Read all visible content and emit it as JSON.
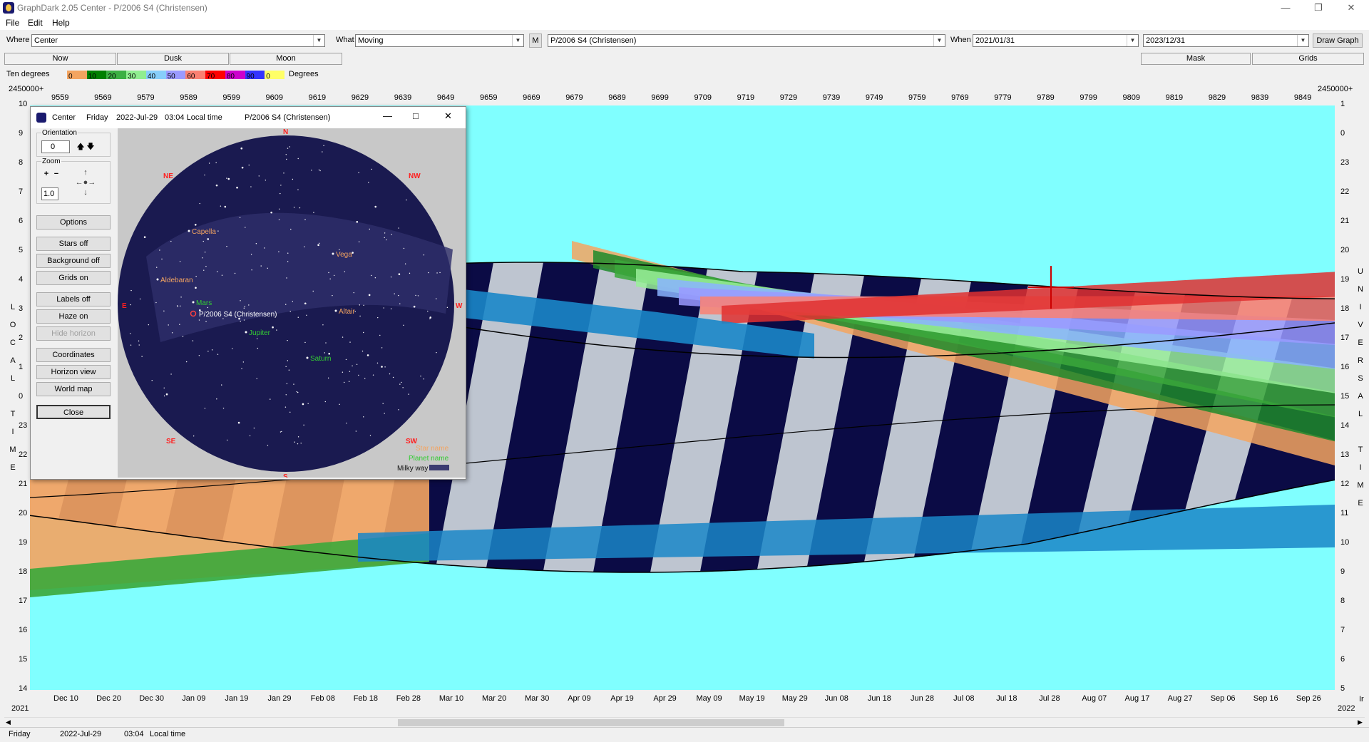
{
  "window": {
    "title": "GraphDark 2.05  Center  -  P/2006 S4 (Christensen)"
  },
  "menu": [
    "File",
    "Edit",
    "Help"
  ],
  "toolbar": {
    "where_label": "Where",
    "where_value": "Center",
    "what_label": "What",
    "what_value": "Moving",
    "m_button": "M",
    "object_value": "P/2006 S4 (Christensen)",
    "when_label": "When",
    "start_date": "2021/01/31",
    "end_date": "2023/12/31",
    "draw_button": "Draw Graph"
  },
  "tabs": {
    "now": "Now",
    "dusk": "Dusk",
    "moon": "Moon",
    "mask": "Mask",
    "grids": "Grids"
  },
  "legend": {
    "left_label": "Ten degrees",
    "right_label": "Degrees",
    "steps": [
      {
        "label": "0",
        "color": "#f4a460"
      },
      {
        "label": "10",
        "color": "#008000"
      },
      {
        "label": "20",
        "color": "#3cb043"
      },
      {
        "label": "30",
        "color": "#90ee90"
      },
      {
        "label": "40",
        "color": "#87cefa"
      },
      {
        "label": "50",
        "color": "#9a9aff"
      },
      {
        "label": "60",
        "color": "#fa8072"
      },
      {
        "label": "70",
        "color": "#ff0000"
      },
      {
        "label": "80",
        "color": "#cc00cc"
      },
      {
        "label": "90",
        "color": "#3333ff"
      },
      {
        "label": "0",
        "color": "#ffff66"
      }
    ]
  },
  "graph": {
    "jd_left": "2450000+",
    "jd_right": "2450000+",
    "jd_ticks": [
      "9559",
      "9569",
      "9579",
      "9589",
      "9599",
      "9609",
      "9619",
      "9629",
      "9639",
      "9649",
      "9659",
      "9669",
      "9679",
      "9689",
      "9699",
      "9709",
      "9719",
      "9729",
      "9739",
      "9749",
      "9759",
      "9769",
      "9779",
      "9789",
      "9799",
      "9809",
      "9819",
      "9829",
      "9839",
      "9849"
    ],
    "date_ticks": [
      "Dec 10",
      "Dec 20",
      "Dec 30",
      "Jan 09",
      "Jan 19",
      "Jan 29",
      "Feb 08",
      "Feb 18",
      "Feb 28",
      "Mar 10",
      "Mar 20",
      "Mar 30",
      "Apr 09",
      "Apr 19",
      "Apr 29",
      "May 09",
      "May 19",
      "May 29",
      "Jun 08",
      "Jun 18",
      "Jun 28",
      "Jul 08",
      "Jul 18",
      "Jul 28",
      "Aug 07",
      "Aug 17",
      "Aug 27",
      "Sep 06",
      "Sep 16",
      "Sep 26"
    ],
    "year_left": "2021",
    "year_right": "2022",
    "year_right_extra": "Ir",
    "left_hours": [
      "10",
      "9",
      "8",
      "7",
      "6",
      "5",
      "4",
      "3",
      "2",
      "1",
      "0",
      "23",
      "22",
      "21",
      "20",
      "19",
      "18",
      "17",
      "16",
      "15",
      "14"
    ],
    "right_hours": [
      "1",
      "0",
      "23",
      "22",
      "21",
      "20",
      "19",
      "18",
      "17",
      "16",
      "15",
      "14",
      "13",
      "12",
      "11",
      "10",
      "9",
      "8",
      "7",
      "6",
      "5"
    ],
    "left_axis_title": [
      "L",
      "O",
      "C",
      "A",
      "L",
      "",
      "T",
      "I",
      "M",
      "E"
    ],
    "right_axis_title": [
      "U",
      "N",
      "I",
      "V",
      "E",
      "R",
      "S",
      "A",
      "L",
      "",
      "T",
      "I",
      "M",
      "E"
    ]
  },
  "sky_window": {
    "title_where": "Center",
    "title_day": "Friday",
    "title_date": "2022-Jul-29",
    "title_time": "03:04 Local time",
    "title_object": "P/2006 S4 (Christensen)",
    "orientation_label": "Orientation",
    "orientation_value": "0",
    "zoom_label": "Zoom",
    "zoom_value": "1.0",
    "buttons": [
      "Options",
      "Stars off",
      "Background off",
      "Grids on",
      "Labels off",
      "Haze on",
      "Hide horizon",
      "Coordinates",
      "Horizon view",
      "World map",
      "Close"
    ],
    "compass": {
      "N": "N",
      "NE": "NE",
      "NW": "NW",
      "E": "E",
      "W": "W",
      "SE": "SE",
      "SW": "SW",
      "S": "S"
    },
    "stars": [
      "Capella",
      "Vega",
      "Aldebaran",
      "Altair"
    ],
    "planets": [
      "Mars",
      "Jupiter",
      "Saturn"
    ],
    "target": "P/2006 S4 (Christensen)",
    "legend_star": "Star name",
    "legend_planet": "Planet name",
    "legend_milky": "Milky way"
  },
  "status": {
    "day": "Friday",
    "date": "2022-Jul-29",
    "time": "03:04",
    "tz": "Local time"
  }
}
